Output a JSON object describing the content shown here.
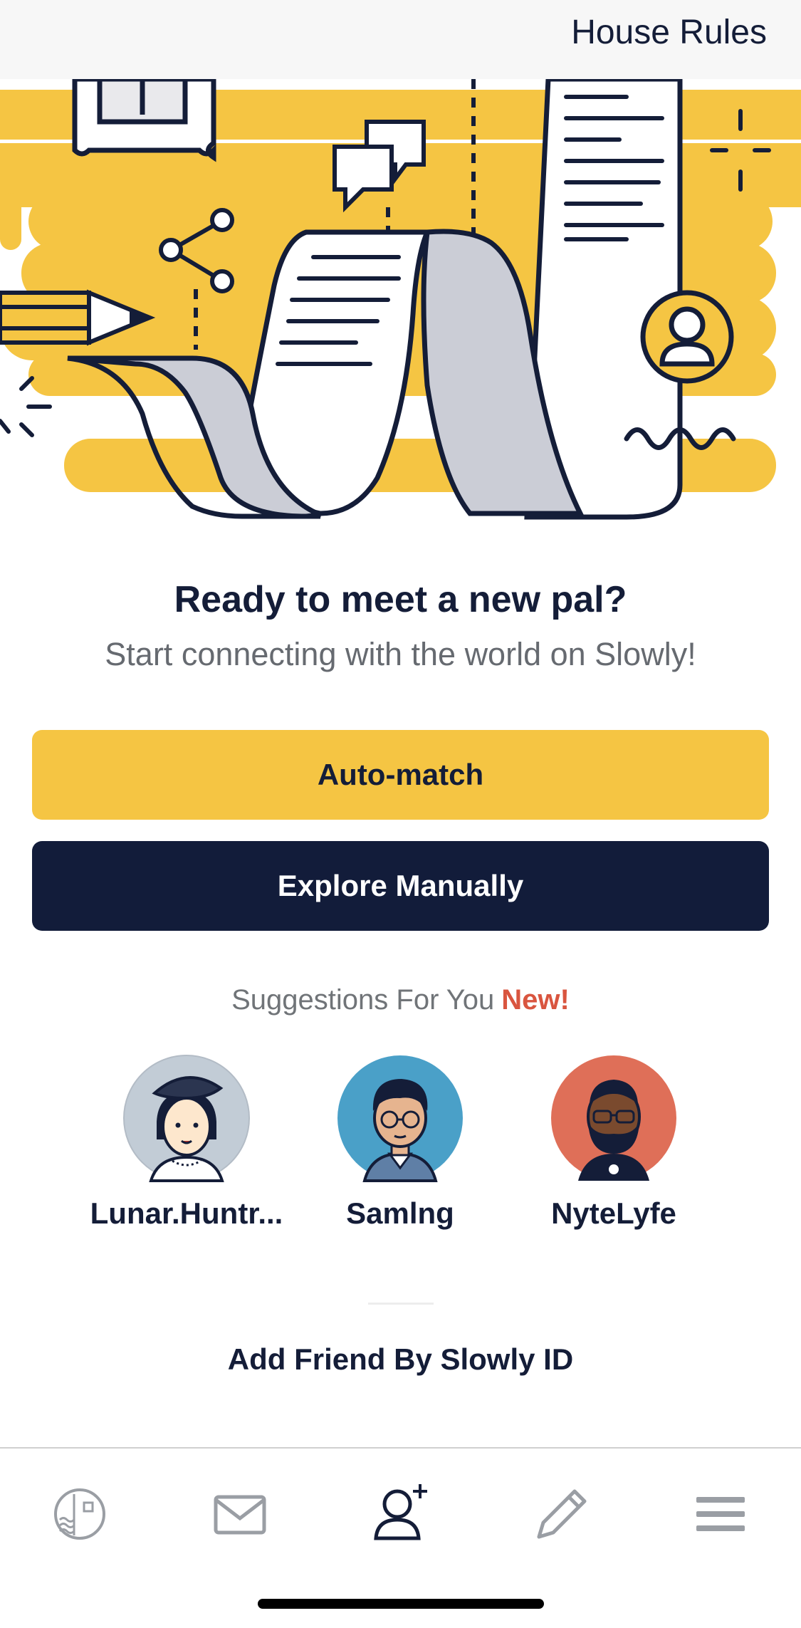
{
  "header": {
    "house_rules": "House Rules"
  },
  "hero": {
    "headline": "Ready to meet a new pal?",
    "subline": "Start connecting with the world on Slowly!"
  },
  "buttons": {
    "auto_match": "Auto-match",
    "explore_manually": "Explore Manually"
  },
  "suggestions": {
    "label": "Suggestions For You",
    "badge": "New!",
    "pals": [
      {
        "name": "Lunar.Huntr...",
        "avatar_color": "#c2ccd6"
      },
      {
        "name": "Samlng",
        "avatar_color": "#4aa0c8"
      },
      {
        "name": "NyteLyfe",
        "avatar_color": "#df6f58"
      }
    ]
  },
  "add_friend": "Add Friend By Slowly ID",
  "tabbar": {
    "tabs": [
      {
        "icon": "stamp-collection-icon",
        "active": false
      },
      {
        "icon": "mail-icon",
        "active": false
      },
      {
        "icon": "add-friend-icon",
        "active": true
      },
      {
        "icon": "pencil-icon",
        "active": false
      },
      {
        "icon": "menu-icon",
        "active": false
      }
    ]
  },
  "colors": {
    "accent_yellow": "#f5c543",
    "navy": "#121c3a",
    "new_badge": "#d9553f"
  }
}
